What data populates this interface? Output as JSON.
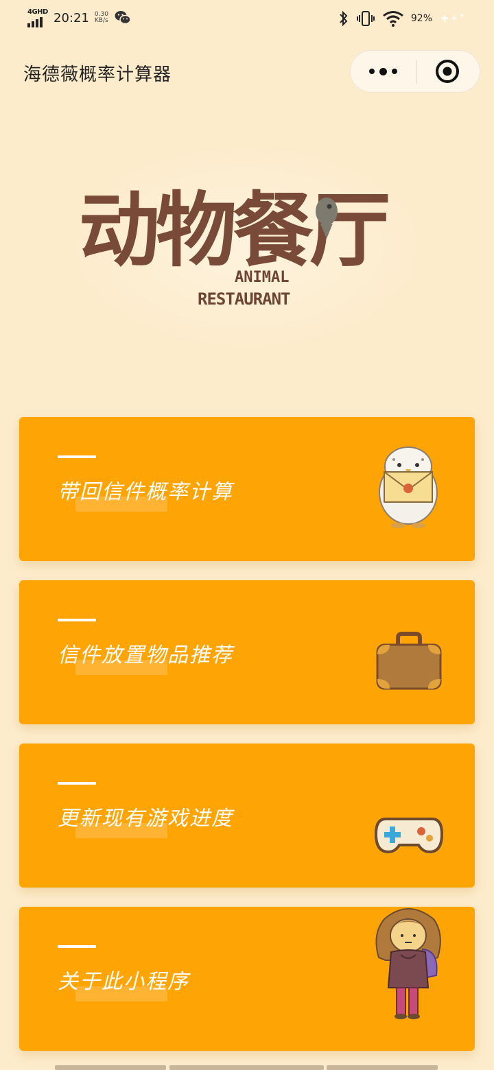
{
  "status_bar": {
    "network": "4GHD",
    "time": "20:21",
    "speed_value": "0.30",
    "speed_unit": "KB/s",
    "battery": "92%"
  },
  "nav": {
    "title": "海德薇概率计算器"
  },
  "logo": {
    "cn": "动物餐厅",
    "en_line1": "ANIMAL",
    "en_line2": "RESTAURANT"
  },
  "menu": [
    {
      "label": "带回信件概率计算",
      "icon": "owl-with-letter-icon"
    },
    {
      "label": "信件放置物品推荐",
      "icon": "suitcase-icon"
    },
    {
      "label": "更新现有游戏进度",
      "icon": "gamepad-icon"
    },
    {
      "label": "关于此小程序",
      "icon": "girl-character-icon"
    }
  ],
  "colors": {
    "background": "#fdeccc",
    "card": "#fea405",
    "logo_brown": "#7a4a38"
  }
}
